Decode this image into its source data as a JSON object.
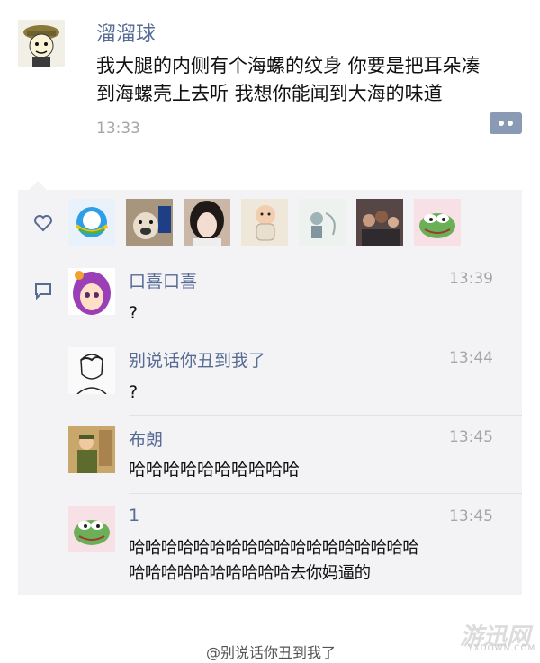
{
  "post": {
    "author": "溜溜球",
    "text_line1": "我大腿的内侧有个海螺的纹身 你要是把耳朵凑",
    "text_line2": "到海螺壳上去听 我想你能闻到大海的味道",
    "time": "13:33",
    "avatar_icon": "cartoon-face-avatar",
    "more_icon": "more-options-icon"
  },
  "likes": {
    "icon": "heart-icon",
    "avatars": [
      "qq-logo-avatar",
      "dog-avatar",
      "girl-avatar",
      "baby-avatar",
      "cartoon-avatar",
      "group-photo-avatar",
      "pepe-frog-avatar"
    ]
  },
  "comments": {
    "icon": "comment-icon",
    "items": [
      {
        "name": "口喜口喜",
        "time": "13:39",
        "text": "?",
        "avatar": "anime-girl-avatar"
      },
      {
        "name": "别说话你丑到我了",
        "time": "13:44",
        "text": "?",
        "avatar": "sketch-man-avatar"
      },
      {
        "name": "布朗",
        "time": "13:45",
        "text": "哈哈哈哈哈哈哈哈哈哈",
        "avatar": "soldier-avatar"
      },
      {
        "name": "1",
        "time": "13:45",
        "text_line1": "哈哈哈哈哈哈哈哈哈哈哈哈哈哈哈哈哈哈",
        "text_line2": "哈哈哈哈哈哈哈哈哈哈去你妈逼的",
        "avatar": "pepe-frog-avatar"
      }
    ]
  },
  "watermarks": {
    "logo": "游迅网",
    "logo_sub": "YXDOWN.COM",
    "user": "@别说话你丑到我了"
  },
  "colors": {
    "link": "#576b95",
    "panel": "#f3f3f5",
    "time": "#a6a6a6"
  }
}
